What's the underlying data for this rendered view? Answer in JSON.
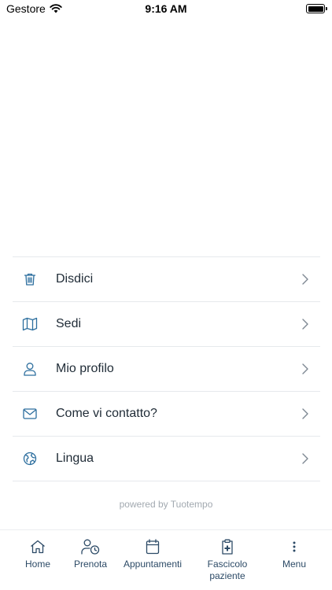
{
  "status_bar": {
    "carrier": "Gestore",
    "time": "9:16 AM"
  },
  "menu": {
    "items": [
      {
        "label": "Disdici",
        "icon": "trash-icon"
      },
      {
        "label": "Sedi",
        "icon": "map-icon"
      },
      {
        "label": "Mio profilo",
        "icon": "user-icon"
      },
      {
        "label": "Come vi contatto?",
        "icon": "mail-icon"
      },
      {
        "label": "Lingua",
        "icon": "globe-icon"
      }
    ]
  },
  "footer": {
    "powered_by": "powered by Tuotempo"
  },
  "tab_bar": {
    "tabs": [
      {
        "label": "Home",
        "icon": "home-icon"
      },
      {
        "label": "Prenota",
        "icon": "user-clock-icon"
      },
      {
        "label": "Appuntamenti",
        "icon": "calendar-icon"
      },
      {
        "label": "Fascicolo paziente",
        "icon": "clipboard-plus-icon"
      },
      {
        "label": "Menu",
        "icon": "more-vertical-icon"
      }
    ]
  },
  "colors": {
    "accent": "#2c6e9e",
    "text": "#1f2b36",
    "divider": "#e6e9ec",
    "muted": "#a2a9b0"
  }
}
